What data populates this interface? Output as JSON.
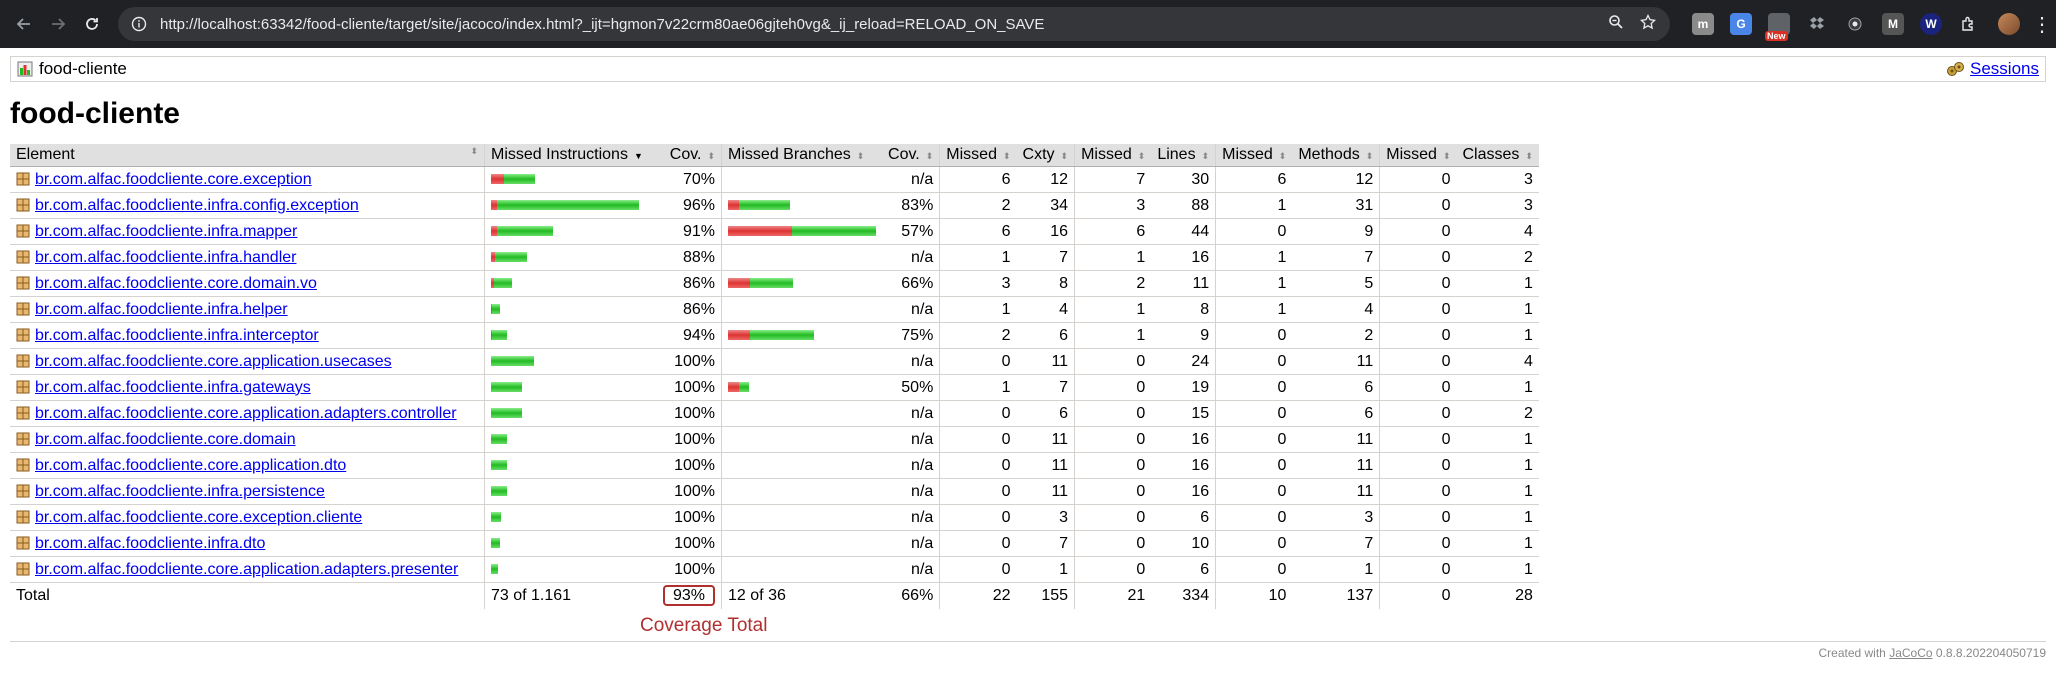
{
  "browser": {
    "url": "http://localhost:63342/food-cliente/target/site/jacoco/index.html?_ijt=hgmon7v22crm80ae06gjteh0vg&_ij_reload=RELOAD_ON_SAVE",
    "extension_badge": "New",
    "extensions": [
      "m",
      "M"
    ]
  },
  "breadcrumb": {
    "project": "food-cliente",
    "sessions_label": "Sessions"
  },
  "title": "food-cliente",
  "columns": [
    "Element",
    "Missed Instructions",
    "Cov.",
    "Missed Branches",
    "Cov.",
    "Missed",
    "Cxty",
    "Missed",
    "Lines",
    "Missed",
    "Methods",
    "Missed",
    "Classes"
  ],
  "rows": [
    {
      "name": "br.com.alfac.foodcliente.core.exception",
      "instr_missed_frac": 0.3,
      "instr_total_rel": 0.3,
      "cov": "70%",
      "br_missed_frac": null,
      "br_total_rel": 0,
      "br_cov": "n/a",
      "cx_missed": "6",
      "cx": "12",
      "ln_missed": "7",
      "lines": "30",
      "mt_missed": "6",
      "methods": "12",
      "cl_missed": "0",
      "classes": "3"
    },
    {
      "name": "br.com.alfac.foodcliente.infra.config.exception",
      "instr_missed_frac": 0.04,
      "instr_total_rel": 1.0,
      "cov": "96%",
      "br_missed_frac": 0.17,
      "br_total_rel": 0.42,
      "br_cov": "83%",
      "cx_missed": "2",
      "cx": "34",
      "ln_missed": "3",
      "lines": "88",
      "mt_missed": "1",
      "methods": "31",
      "cl_missed": "0",
      "classes": "3"
    },
    {
      "name": "br.com.alfac.foodcliente.infra.mapper",
      "instr_missed_frac": 0.09,
      "instr_total_rel": 0.42,
      "cov": "91%",
      "br_missed_frac": 0.43,
      "br_total_rel": 1.0,
      "br_cov": "57%",
      "cx_missed": "6",
      "cx": "16",
      "ln_missed": "6",
      "lines": "44",
      "mt_missed": "0",
      "methods": "9",
      "cl_missed": "0",
      "classes": "4"
    },
    {
      "name": "br.com.alfac.foodcliente.infra.handler",
      "instr_missed_frac": 0.12,
      "instr_total_rel": 0.24,
      "cov": "88%",
      "br_missed_frac": null,
      "br_total_rel": 0,
      "br_cov": "n/a",
      "cx_missed": "1",
      "cx": "7",
      "ln_missed": "1",
      "lines": "16",
      "mt_missed": "1",
      "methods": "7",
      "cl_missed": "0",
      "classes": "2"
    },
    {
      "name": "br.com.alfac.foodcliente.core.domain.vo",
      "instr_missed_frac": 0.14,
      "instr_total_rel": 0.14,
      "cov": "86%",
      "br_missed_frac": 0.34,
      "br_total_rel": 0.44,
      "br_cov": "66%",
      "cx_missed": "3",
      "cx": "8",
      "ln_missed": "2",
      "lines": "11",
      "mt_missed": "1",
      "methods": "5",
      "cl_missed": "0",
      "classes": "1"
    },
    {
      "name": "br.com.alfac.foodcliente.infra.helper",
      "instr_missed_frac": 0.14,
      "instr_total_rel": 0.06,
      "cov": "86%",
      "br_missed_frac": null,
      "br_total_rel": 0,
      "br_cov": "n/a",
      "cx_missed": "1",
      "cx": "4",
      "ln_missed": "1",
      "lines": "8",
      "mt_missed": "1",
      "methods": "4",
      "cl_missed": "0",
      "classes": "1"
    },
    {
      "name": "br.com.alfac.foodcliente.infra.interceptor",
      "instr_missed_frac": 0.06,
      "instr_total_rel": 0.11,
      "cov": "94%",
      "br_missed_frac": 0.25,
      "br_total_rel": 0.58,
      "br_cov": "75%",
      "cx_missed": "2",
      "cx": "6",
      "ln_missed": "1",
      "lines": "9",
      "mt_missed": "0",
      "methods": "2",
      "cl_missed": "0",
      "classes": "1"
    },
    {
      "name": "br.com.alfac.foodcliente.core.application.usecases",
      "instr_missed_frac": 0,
      "instr_total_rel": 0.29,
      "cov": "100%",
      "br_missed_frac": null,
      "br_total_rel": 0,
      "br_cov": "n/a",
      "cx_missed": "0",
      "cx": "11",
      "ln_missed": "0",
      "lines": "24",
      "mt_missed": "0",
      "methods": "11",
      "cl_missed": "0",
      "classes": "4"
    },
    {
      "name": "br.com.alfac.foodcliente.infra.gateways",
      "instr_missed_frac": 0,
      "instr_total_rel": 0.21,
      "cov": "100%",
      "br_missed_frac": 0.5,
      "br_total_rel": 0.14,
      "br_cov": "50%",
      "cx_missed": "1",
      "cx": "7",
      "ln_missed": "0",
      "lines": "19",
      "mt_missed": "0",
      "methods": "6",
      "cl_missed": "0",
      "classes": "1"
    },
    {
      "name": "br.com.alfac.foodcliente.core.application.adapters.controller",
      "instr_missed_frac": 0,
      "instr_total_rel": 0.21,
      "cov": "100%",
      "br_missed_frac": null,
      "br_total_rel": 0,
      "br_cov": "n/a",
      "cx_missed": "0",
      "cx": "6",
      "ln_missed": "0",
      "lines": "15",
      "mt_missed": "0",
      "methods": "6",
      "cl_missed": "0",
      "classes": "2"
    },
    {
      "name": "br.com.alfac.foodcliente.core.domain",
      "instr_missed_frac": 0,
      "instr_total_rel": 0.11,
      "cov": "100%",
      "br_missed_frac": null,
      "br_total_rel": 0,
      "br_cov": "n/a",
      "cx_missed": "0",
      "cx": "11",
      "ln_missed": "0",
      "lines": "16",
      "mt_missed": "0",
      "methods": "11",
      "cl_missed": "0",
      "classes": "1"
    },
    {
      "name": "br.com.alfac.foodcliente.core.application.dto",
      "instr_missed_frac": 0,
      "instr_total_rel": 0.11,
      "cov": "100%",
      "br_missed_frac": null,
      "br_total_rel": 0,
      "br_cov": "n/a",
      "cx_missed": "0",
      "cx": "11",
      "ln_missed": "0",
      "lines": "16",
      "mt_missed": "0",
      "methods": "11",
      "cl_missed": "0",
      "classes": "1"
    },
    {
      "name": "br.com.alfac.foodcliente.infra.persistence",
      "instr_missed_frac": 0,
      "instr_total_rel": 0.11,
      "cov": "100%",
      "br_missed_frac": null,
      "br_total_rel": 0,
      "br_cov": "n/a",
      "cx_missed": "0",
      "cx": "11",
      "ln_missed": "0",
      "lines": "16",
      "mt_missed": "0",
      "methods": "11",
      "cl_missed": "0",
      "classes": "1"
    },
    {
      "name": "br.com.alfac.foodcliente.core.exception.cliente",
      "instr_missed_frac": 0,
      "instr_total_rel": 0.07,
      "cov": "100%",
      "br_missed_frac": null,
      "br_total_rel": 0,
      "br_cov": "n/a",
      "cx_missed": "0",
      "cx": "3",
      "ln_missed": "0",
      "lines": "6",
      "mt_missed": "0",
      "methods": "3",
      "cl_missed": "0",
      "classes": "1"
    },
    {
      "name": "br.com.alfac.foodcliente.infra.dto",
      "instr_missed_frac": 0,
      "instr_total_rel": 0.06,
      "cov": "100%",
      "br_missed_frac": null,
      "br_total_rel": 0,
      "br_cov": "n/a",
      "cx_missed": "0",
      "cx": "7",
      "ln_missed": "0",
      "lines": "10",
      "mt_missed": "0",
      "methods": "7",
      "cl_missed": "0",
      "classes": "1"
    },
    {
      "name": "br.com.alfac.foodcliente.core.application.adapters.presenter",
      "instr_missed_frac": 0,
      "instr_total_rel": 0.05,
      "cov": "100%",
      "br_missed_frac": null,
      "br_total_rel": 0,
      "br_cov": "n/a",
      "cx_missed": "0",
      "cx": "1",
      "ln_missed": "0",
      "lines": "6",
      "mt_missed": "0",
      "methods": "1",
      "cl_missed": "0",
      "classes": "1"
    }
  ],
  "total": {
    "label": "Total",
    "instr": "73 of 1.161",
    "cov": "93%",
    "branches": "12 of 36",
    "br_cov": "66%",
    "cx_missed": "22",
    "cx": "155",
    "ln_missed": "21",
    "lines": "334",
    "mt_missed": "10",
    "methods": "137",
    "cl_missed": "0",
    "classes": "28"
  },
  "annotation": "Coverage Total",
  "footer": {
    "prefix": "Created with ",
    "link": "JaCoCo",
    "version": " 0.8.8.202204050719"
  },
  "colors": {
    "missed": "#d33333",
    "covered": "#22bb22",
    "annotation": "#b03030"
  }
}
